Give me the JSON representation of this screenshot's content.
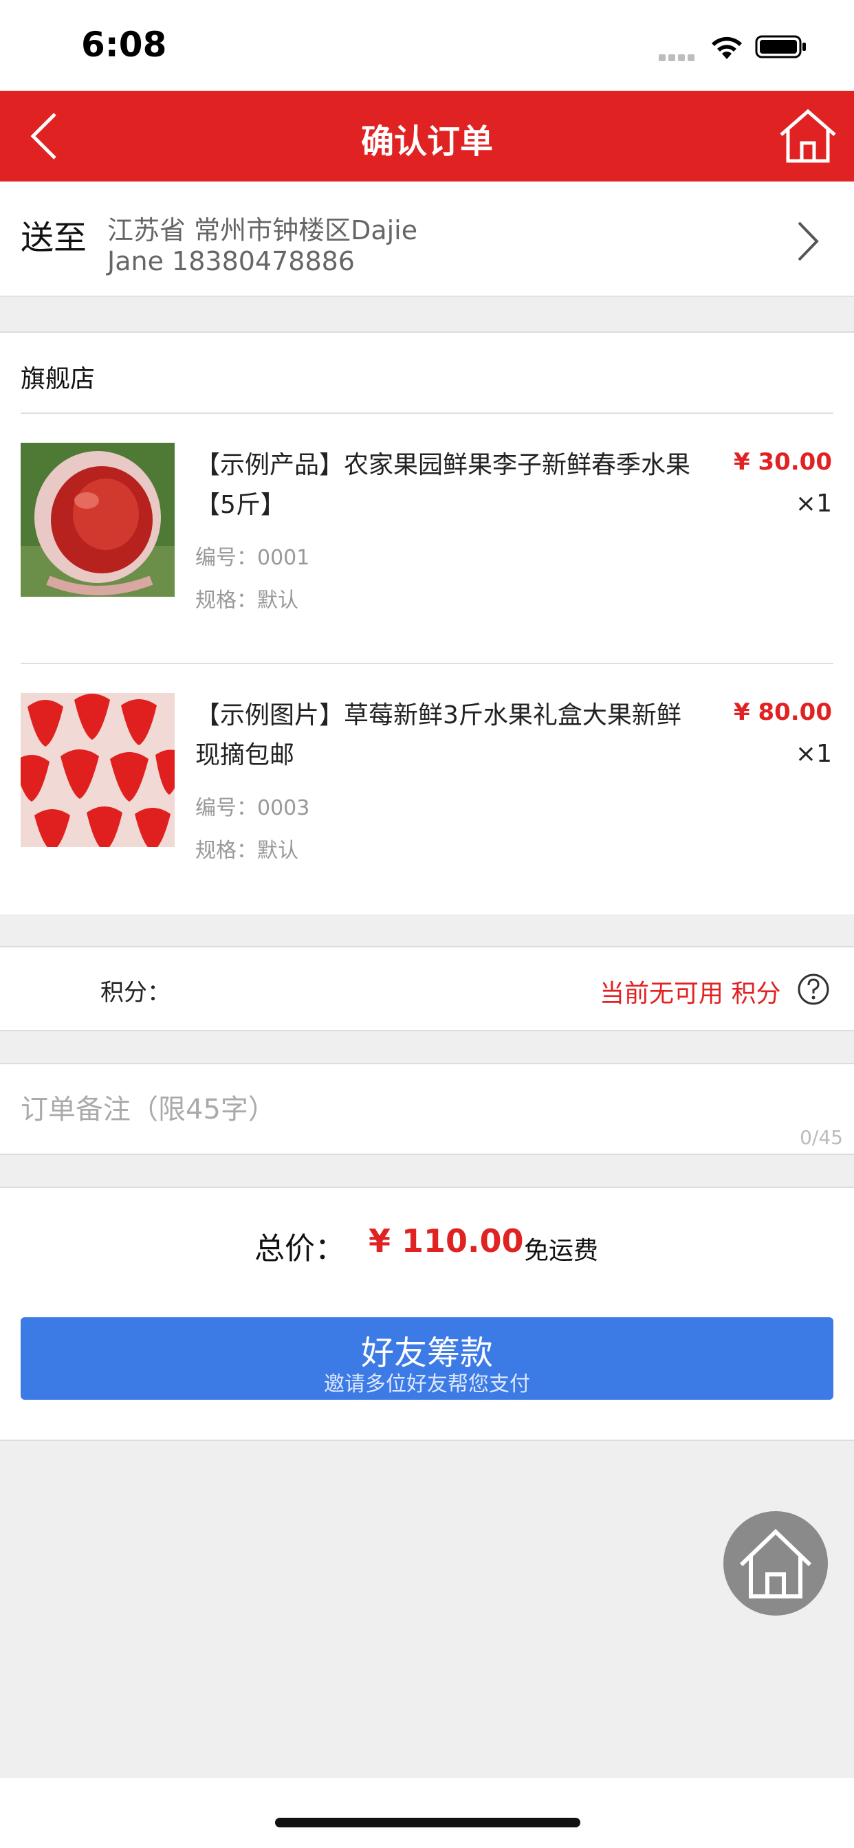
{
  "status_bar": {
    "time": "6:08"
  },
  "header": {
    "title": "确认订单",
    "back_icon": "chevron-left-icon",
    "home_icon": "home-icon"
  },
  "address": {
    "label": "送至",
    "line1": "江苏省 常州市钟楼区Dajie",
    "line2": "Jane 18380478886"
  },
  "shop": {
    "name": "旗舰店",
    "products": [
      {
        "title": "【示例产品】农家果园鲜果李子新鲜春季水果【5斤】",
        "code": "编号：0001",
        "spec": "规格：默认",
        "price": "¥ 30.00",
        "qty": "×1",
        "image": "plum-photo"
      },
      {
        "title": "【示例图片】草莓新鲜3斤水果礼盒大果新鲜现摘包邮",
        "code": "编号：0003",
        "spec": "规格：默认",
        "price": "¥ 80.00",
        "qty": "×1",
        "image": "strawberry-photo"
      }
    ]
  },
  "points": {
    "label": "积分：",
    "value": "当前无可用 积分",
    "help_icon": "question-circle-icon"
  },
  "remark": {
    "placeholder": "订单备注（限45字）",
    "value": "",
    "counter": "0/45"
  },
  "total": {
    "label": "总价：",
    "value": "¥ 110.00",
    "shipping": "免运费"
  },
  "fund_button": {
    "title": "好友筹款",
    "subtitle": "邀请多位好友帮您支付"
  },
  "colors": {
    "accent_red": "#e02223",
    "button_blue": "#3c7ae6",
    "background_gray": "#efefef"
  }
}
